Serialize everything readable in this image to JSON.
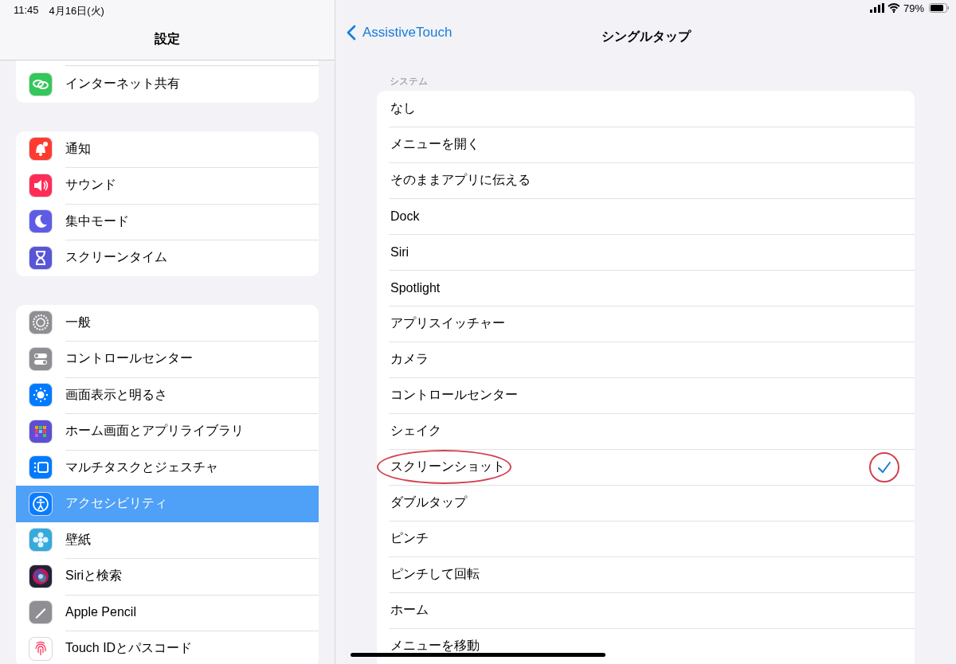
{
  "status_bar": {
    "time": "11:45",
    "date": "4月16日(火)",
    "battery": "79%"
  },
  "sidebar": {
    "title": "設定",
    "groups": [
      {
        "clipped_top": true,
        "items": [
          {
            "label": "インターネット共有",
            "color": "#34c759",
            "selected": false
          }
        ]
      },
      {
        "clipped_top": false,
        "items": [
          {
            "label": "通知",
            "color": "#ff3b30",
            "selected": false
          },
          {
            "label": "サウンド",
            "color": "#ff2d55",
            "selected": false
          },
          {
            "label": "集中モード",
            "color": "#5e5ce6",
            "selected": false
          },
          {
            "label": "スクリーンタイム",
            "color": "#5856d6",
            "selected": false
          }
        ]
      },
      {
        "clipped_top": false,
        "items": [
          {
            "label": "一般",
            "color": "#8e8e93",
            "selected": false
          },
          {
            "label": "コントロールセンター",
            "color": "#8e8e93",
            "selected": false
          },
          {
            "label": "画面表示と明るさ",
            "color": "#007aff",
            "selected": false
          },
          {
            "label": "ホーム画面とアプリライブラリ",
            "color": "#5b4fd6",
            "selected": false
          },
          {
            "label": "マルチタスクとジェスチャ",
            "color": "#007aff",
            "selected": false
          },
          {
            "label": "アクセシビリティ",
            "color": "#0a7cff",
            "selected": true
          },
          {
            "label": "壁紙",
            "color": "#35aadc",
            "selected": false
          },
          {
            "label": "Siriと検索",
            "color": "#222233",
            "selected": false
          },
          {
            "label": "Apple Pencil",
            "color": "#8e8e93",
            "selected": false
          },
          {
            "label": "Touch IDとパスコード",
            "color": "#ffffff",
            "selected": false
          }
        ]
      }
    ]
  },
  "detail": {
    "back": "AssistiveTouch",
    "title": "シングルタップ",
    "section": "システム",
    "options": [
      {
        "label": "なし",
        "checked": false,
        "annotated": false
      },
      {
        "label": "メニューを開く",
        "checked": false,
        "annotated": false
      },
      {
        "label": "そのままアプリに伝える",
        "checked": false,
        "annotated": false
      },
      {
        "label": "Dock",
        "checked": false,
        "annotated": false
      },
      {
        "label": "Siri",
        "checked": false,
        "annotated": false
      },
      {
        "label": "Spotlight",
        "checked": false,
        "annotated": false
      },
      {
        "label": "アプリスイッチャー",
        "checked": false,
        "annotated": false
      },
      {
        "label": "カメラ",
        "checked": false,
        "annotated": false
      },
      {
        "label": "コントロールセンター",
        "checked": false,
        "annotated": false
      },
      {
        "label": "シェイク",
        "checked": false,
        "annotated": false
      },
      {
        "label": "スクリーンショット",
        "checked": true,
        "annotated": true
      },
      {
        "label": "ダブルタップ",
        "checked": false,
        "annotated": false
      },
      {
        "label": "ピンチ",
        "checked": false,
        "annotated": false
      },
      {
        "label": "ピンチして回転",
        "checked": false,
        "annotated": false
      },
      {
        "label": "ホーム",
        "checked": false,
        "annotated": false
      },
      {
        "label": "メニューを移動",
        "checked": false,
        "annotated": false
      }
    ]
  }
}
